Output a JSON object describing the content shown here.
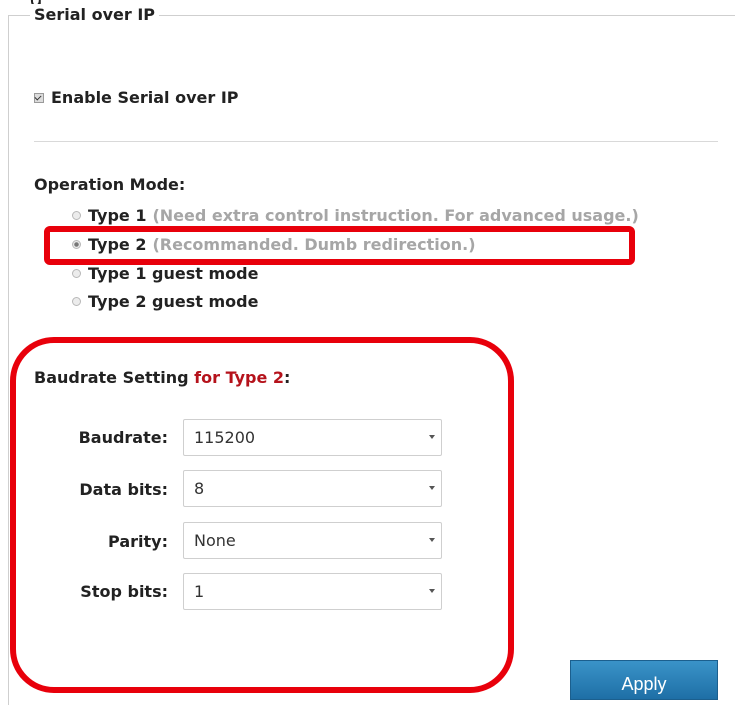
{
  "page": {
    "top_cut_text": "g"
  },
  "fieldset": {
    "legend": "Serial over IP"
  },
  "enable": {
    "label": "Enable Serial over IP",
    "checked": true
  },
  "operation": {
    "label": "Operation Mode:",
    "options": [
      {
        "name": "Type 1",
        "hint": "(Need extra control instruction. For advanced usage.)",
        "selected": false
      },
      {
        "name": "Type 2",
        "hint": "(Recommanded. Dumb redirection.)",
        "selected": true
      },
      {
        "name": "Type 1 guest mode",
        "hint": "",
        "selected": false
      },
      {
        "name": "Type 2 guest mode",
        "hint": "",
        "selected": false
      }
    ]
  },
  "baudrate_setting": {
    "title_prefix": "Baudrate Setting ",
    "title_highlight": "for Type 2",
    "title_suffix": ":",
    "fields": [
      {
        "label": "Baudrate:",
        "value": "115200"
      },
      {
        "label": "Data bits:",
        "value": "8"
      },
      {
        "label": "Parity:",
        "value": "None"
      },
      {
        "label": "Stop bits:",
        "value": "1"
      }
    ]
  },
  "actions": {
    "apply_label": "Apply"
  },
  "colors": {
    "highlight": "#e8000b",
    "accent_text": "#b5121b",
    "button": "#2a80b9"
  }
}
